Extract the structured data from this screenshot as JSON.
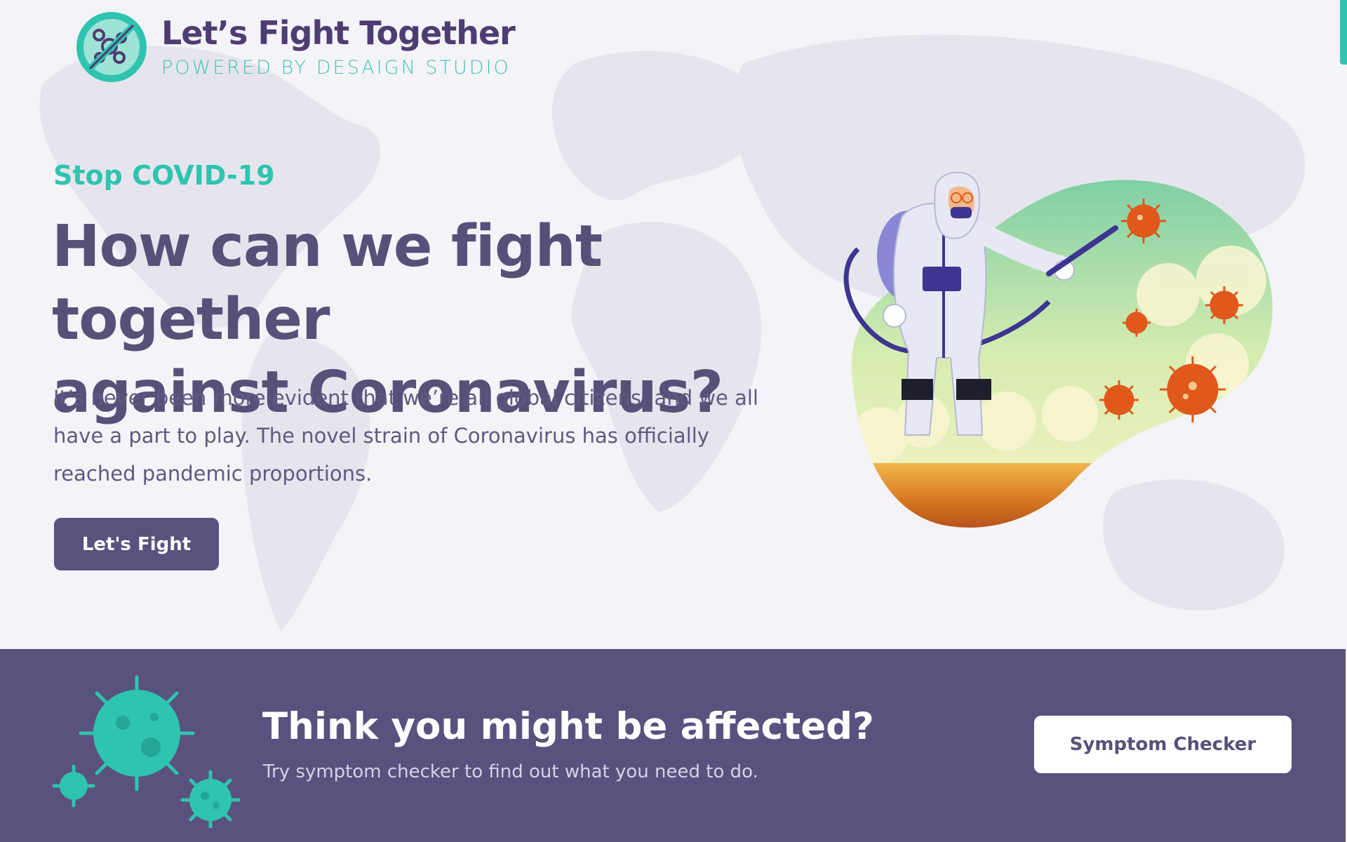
{
  "brand": {
    "title": "Let’s Fight Together",
    "subtitle": "POWERED BY DESAIGN STUDIO",
    "logo_icon": "no-virus-icon"
  },
  "hero": {
    "eyebrow": "Stop COVID-19",
    "headline_line1": "How can we fight together",
    "headline_line2": "against Coronavirus?",
    "lead": "It’s never been more evident that we’re all global citizens, and we all have a part to play. The novel strain of Coronavirus has officially reached pandemic proportions.",
    "cta_label": "Let's Fight",
    "illustration": "disinfection-worker-illustration"
  },
  "banner": {
    "title": "Think you might be affected?",
    "subtitle": "Try symptom checker to find out what you need to do.",
    "button_label": "Symptom Checker",
    "icon": "virus-cluster-icon"
  },
  "colors": {
    "primary": "#5a517e",
    "accent": "#2ec4b0",
    "background": "#f4f3f8",
    "virus_orange": "#e0581c"
  }
}
